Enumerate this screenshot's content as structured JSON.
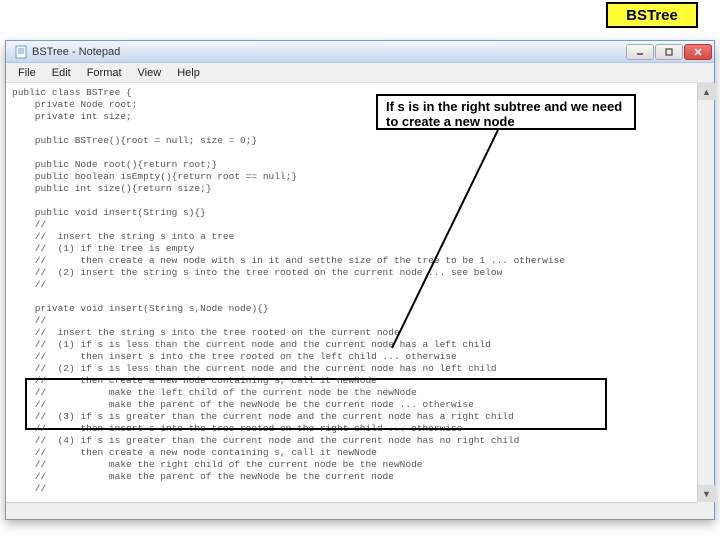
{
  "slide_label": "BSTree",
  "window": {
    "title": "BSTree - Notepad",
    "menus": [
      "File",
      "Edit",
      "Format",
      "View",
      "Help"
    ]
  },
  "callout": "If s is in the right subtree and we need to create a new node",
  "code": "public class BSTree {\n    private Node root;\n    private int size;\n\n    public BSTree(){root = null; size = 0;}\n\n    public Node root(){return root;}\n    public boolean isEmpty(){return root == null;}\n    public int size(){return size;}\n\n    public void insert(String s){}\n    //\n    //  insert the string s into a tree\n    //  (1) if the tree is empty\n    //      then create a new node with s in it and setthe size of the tree to be 1 ... otherwise\n    //  (2) insert the string s into the tree rooted on the current node ... see below\n    //\n\n    private void insert(String s,Node node){}\n    //\n    //  insert the string s into the tree rooted on the current node\n    //  (1) if s is less than the current node and the current node has a left child\n    //      then insert s into the tree rooted on the left child ... otherwise\n    //  (2) if s is less than the current node and the current node has no left child\n    //      then create a new node containing s, call it newNode\n    //           make the left child of the current node be the newNode\n    //           make the parent of the newNode be the current node ... otherwise\n    //  (3) if s is greater than the current node and the current node has a right child\n    //      then insert s into the tree rooted on the right child ... otherwise\n    //  (4) if s is greater than the current node and the current node has no right child\n    //      then create a new node containing s, call it newNode\n    //           make the right child of the current node be the newNode\n    //           make the parent of the newNode be the current node\n    //\n\n\n    public boolean isPresent(String s){return root != null && find(s,root)!= null;}\n    //\n    // s is present if the tree isn't empty and we can find a node that contains s"
}
